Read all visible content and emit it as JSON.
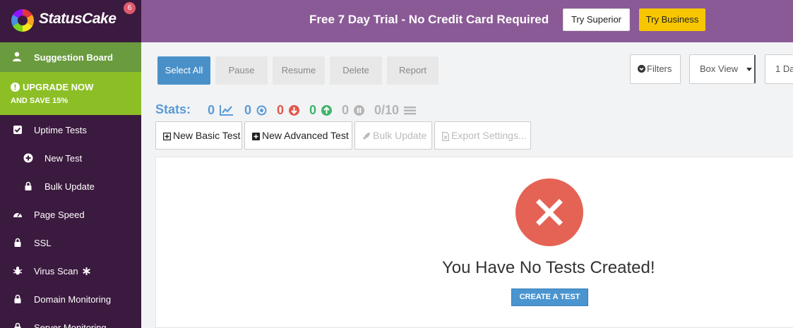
{
  "header": {
    "brand": "StatusCake",
    "notification_count": "6",
    "trial_text": "Free 7 Day Trial - No Credit Card Required",
    "try_superior": "Try Superior",
    "try_business": "Try Business"
  },
  "sidebar": {
    "suggestion_board": "Suggestion Board",
    "upgrade_line1": "UPGRADE NOW",
    "upgrade_line2": "AND SAVE 15%",
    "items": [
      {
        "label": "Uptime Tests",
        "icon": "check-square-icon"
      },
      {
        "label": "New Test",
        "icon": "plus-circle-icon"
      },
      {
        "label": "Bulk Update",
        "icon": "lock-icon"
      },
      {
        "label": "Page Speed",
        "icon": "speedometer-icon"
      },
      {
        "label": "SSL",
        "icon": "lock-icon"
      },
      {
        "label": "Virus Scan",
        "icon": "bug-icon"
      },
      {
        "label": "Domain Monitoring",
        "icon": "lock-icon"
      },
      {
        "label": "Server Monitoring",
        "icon": "lock-icon"
      }
    ]
  },
  "toolbar": {
    "select_all": "Select All",
    "pause": "Pause",
    "resume": "Resume",
    "delete": "Delete",
    "report": "Report",
    "filters": "Filters",
    "view": "Box View",
    "period": "1 Da"
  },
  "stats": {
    "label": "Stats:",
    "total": "0",
    "active": "0",
    "down": "0",
    "up": "0",
    "paused": "0",
    "quota": "0/10"
  },
  "actions": {
    "new_basic": "New Basic Test",
    "new_advanced": "New Advanced Test",
    "bulk_update": "Bulk Update",
    "export_settings": "Export Settings..."
  },
  "empty": {
    "title": "You Have No Tests Created!",
    "cta": "CREATE A TEST"
  },
  "colors": {
    "brand_purple": "#8a5a96",
    "sidebar_dark": "#3b1a3f",
    "suggest_green": "#6a9b3f",
    "upgrade_green": "#8cbf26",
    "accent_blue": "#4a90c8",
    "down_red": "#e0584a",
    "up_green": "#3fb56b",
    "cta_yellow": "#f7c600"
  }
}
